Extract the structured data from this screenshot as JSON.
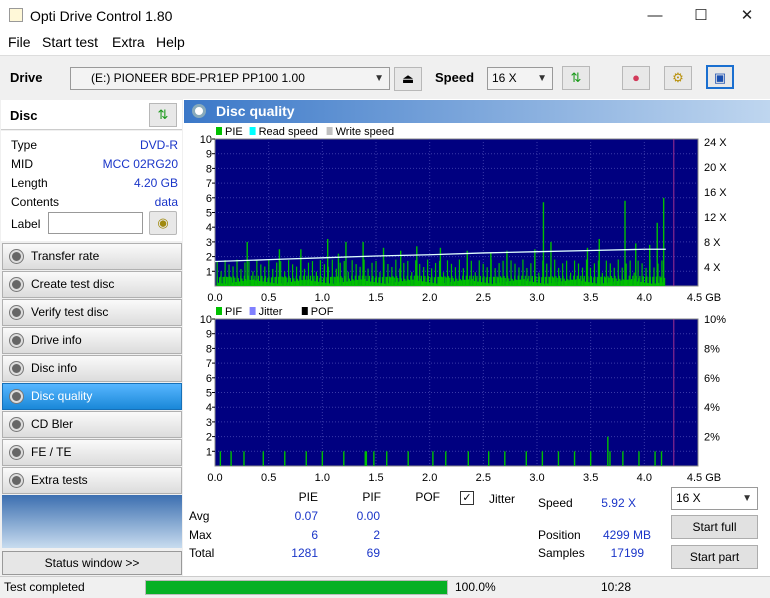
{
  "window": {
    "title": "Opti Drive Control 1.80"
  },
  "menu": [
    "File",
    "Start test",
    "Extra",
    "Help"
  ],
  "toolbar": {
    "drive_label": "Drive",
    "drive_value": "(E:)  PIONEER BDE-PR1EP  PP100 1.00",
    "speed_label": "Speed",
    "speed_value": "16 X"
  },
  "disc": {
    "header": "Disc",
    "type_k": "Type",
    "type_v": "DVD-R",
    "mid_k": "MID",
    "mid_v": "MCC 02RG20",
    "length_k": "Length",
    "length_v": "4.20 GB",
    "contents_k": "Contents",
    "contents_v": "data",
    "label_k": "Label",
    "label_v": ""
  },
  "nav": [
    "Transfer rate",
    "Create test disc",
    "Verify test disc",
    "Drive info",
    "Disc info",
    "Disc quality",
    "CD Bler",
    "FE / TE",
    "Extra tests"
  ],
  "nav_selected": 5,
  "status_window_btn": "Status window >>",
  "panel_title": "Disc quality",
  "chart_data": [
    {
      "type": "bar",
      "legend": [
        "PIE",
        "Read speed",
        "Write speed"
      ],
      "legend_colors": [
        "#00c000",
        "#00ffff",
        "#c0c0c0"
      ],
      "x_ticks": [
        "0.0",
        "0.5",
        "1.0",
        "1.5",
        "2.0",
        "2.5",
        "3.0",
        "3.5",
        "4.0",
        "4.5 GB"
      ],
      "y_ticks_left": [
        "10",
        "9",
        "8",
        "7",
        "6",
        "5",
        "4",
        "3",
        "2",
        "1"
      ],
      "y_ticks_right": [
        "24 X",
        "20 X",
        "16 X",
        "12 X",
        "8 X",
        "4 X"
      ],
      "xlim": [
        0,
        4.5
      ],
      "ylim": [
        0,
        10
      ],
      "y2lim": [
        0,
        24
      ],
      "disc_end": 4.2,
      "spikes": [
        [
          0.3,
          3
        ],
        [
          0.6,
          2.5
        ],
        [
          0.8,
          2.5
        ],
        [
          1.05,
          3.2
        ],
        [
          1.15,
          2.2
        ],
        [
          1.22,
          3
        ],
        [
          1.38,
          3
        ],
        [
          1.57,
          2.6
        ],
        [
          1.73,
          2.4
        ],
        [
          1.88,
          2.7
        ],
        [
          2.1,
          2.6
        ],
        [
          2.35,
          2.4
        ],
        [
          2.57,
          2.3
        ],
        [
          2.72,
          2.4
        ],
        [
          2.98,
          2.5
        ],
        [
          3.06,
          5.7
        ],
        [
          3.13,
          3
        ],
        [
          3.47,
          2.6
        ],
        [
          3.58,
          3.2
        ],
        [
          3.82,
          5.8
        ],
        [
          3.92,
          2.9
        ],
        [
          4.05,
          2.8
        ],
        [
          4.12,
          4.3
        ],
        [
          4.18,
          6
        ]
      ],
      "speed_x": [
        0.0,
        0.5,
        1.0,
        1.5,
        2.0,
        2.5,
        3.0,
        3.5,
        4.0,
        4.2
      ],
      "speed_y": [
        4.0,
        4.3,
        4.6,
        4.9,
        5.1,
        5.4,
        5.6,
        5.8,
        6.0,
        6.0
      ]
    },
    {
      "type": "bar",
      "legend": [
        "PIF",
        "Jitter",
        "POF"
      ],
      "legend_colors": [
        "#00c000",
        "#8080ff",
        "#000000"
      ],
      "x_ticks": [
        "0.0",
        "0.5",
        "1.0",
        "1.5",
        "2.0",
        "2.5",
        "3.0",
        "3.5",
        "4.0",
        "4.5 GB"
      ],
      "y_ticks_left": [
        "10",
        "9",
        "8",
        "7",
        "6",
        "5",
        "4",
        "3",
        "2",
        "1"
      ],
      "y_ticks_right": [
        "10%",
        "8%",
        "6%",
        "4%",
        "2%"
      ],
      "xlim": [
        0,
        4.5
      ],
      "ylim": [
        0,
        10
      ],
      "disc_end": 4.2,
      "bars": [
        [
          0.05,
          1
        ],
        [
          0.15,
          1
        ],
        [
          0.27,
          1
        ],
        [
          0.45,
          1
        ],
        [
          0.65,
          1
        ],
        [
          0.85,
          1
        ],
        [
          1.0,
          1
        ],
        [
          1.2,
          1
        ],
        [
          1.4,
          1
        ],
        [
          1.41,
          1
        ],
        [
          1.48,
          1
        ],
        [
          1.6,
          1
        ],
        [
          1.8,
          1
        ],
        [
          2.03,
          1
        ],
        [
          2.15,
          1
        ],
        [
          2.36,
          1
        ],
        [
          2.55,
          1
        ],
        [
          2.7,
          1
        ],
        [
          2.9,
          1
        ],
        [
          3.05,
          1
        ],
        [
          3.2,
          1
        ],
        [
          3.35,
          1
        ],
        [
          3.5,
          1
        ],
        [
          3.66,
          2
        ],
        [
          3.68,
          1
        ],
        [
          3.8,
          1
        ],
        [
          3.95,
          1
        ],
        [
          4.1,
          1
        ],
        [
          4.16,
          1
        ]
      ]
    }
  ],
  "stats": {
    "hdr_pie": "PIE",
    "hdr_pif": "PIF",
    "hdr_pof": "POF",
    "jitter_lbl": "Jitter",
    "jitter_checked": "✓",
    "avg_lbl": "Avg",
    "avg_pie": "0.07",
    "avg_pif": "0.00",
    "max_lbl": "Max",
    "max_pie": "6",
    "max_pif": "2",
    "total_lbl": "Total",
    "total_pie": "1281",
    "total_pif": "69",
    "speed_lbl": "Speed",
    "speed_val": "5.92 X",
    "speed_sel": "16 X",
    "pos_lbl": "Position",
    "pos_val": "4299 MB",
    "samples_lbl": "Samples",
    "samples_val": "17199",
    "start_full": "Start full",
    "start_part": "Start part"
  },
  "status": {
    "text": "Test completed",
    "progress": 1.0,
    "percent": "100.0%",
    "time": "10:28"
  }
}
